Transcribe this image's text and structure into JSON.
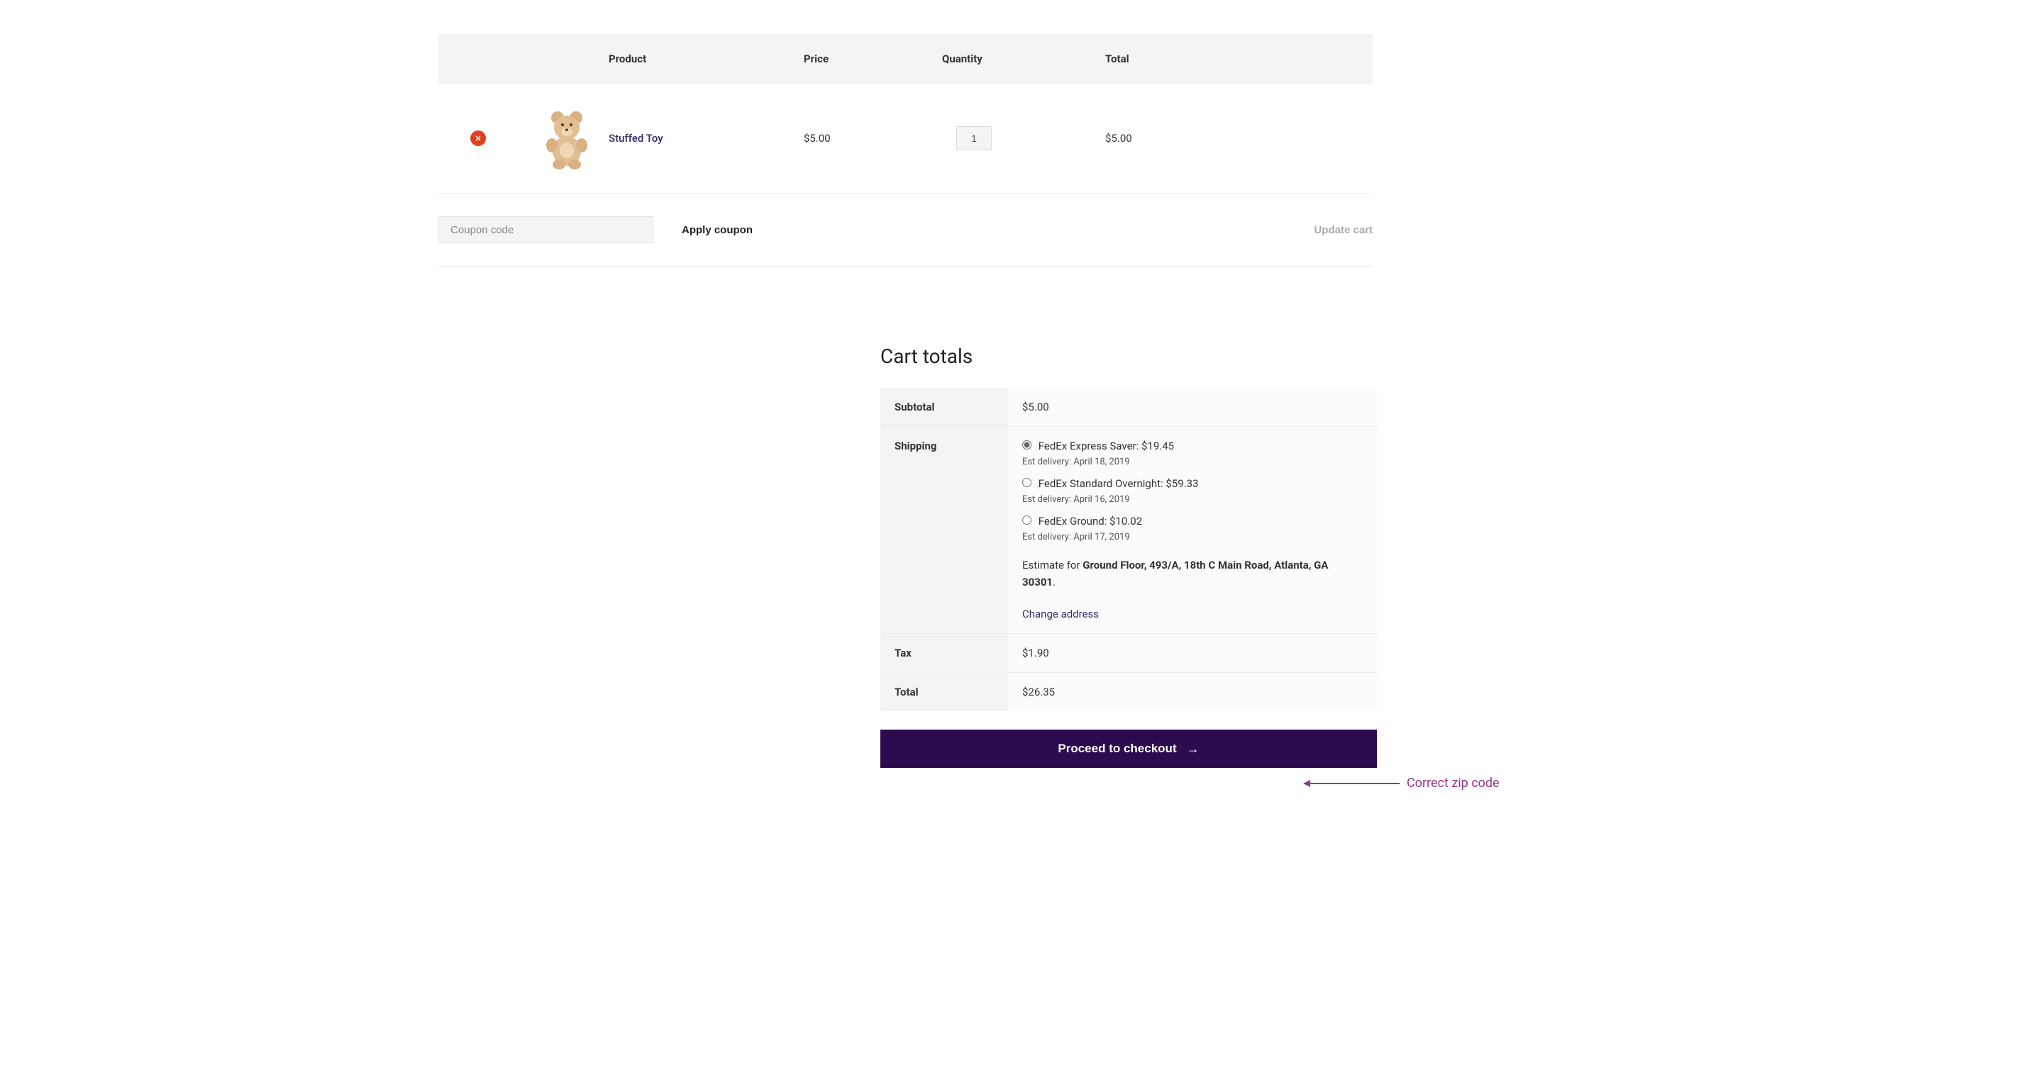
{
  "cart_table": {
    "headers": {
      "product": "Product",
      "price": "Price",
      "quantity": "Quantity",
      "total": "Total"
    },
    "items": [
      {
        "name": "Stuffed Toy",
        "price": "$5.00",
        "qty": "1",
        "line_total": "$5.00"
      }
    ]
  },
  "coupon": {
    "placeholder": "Coupon code",
    "apply_label": "Apply coupon"
  },
  "update_cart_label": "Update cart",
  "cart_totals": {
    "title": "Cart totals",
    "subtotal_label": "Subtotal",
    "subtotal_value": "$5.00",
    "shipping_label": "Shipping",
    "shipping_options": [
      {
        "label": "FedEx Express Saver: $19.45",
        "est": "Est delivery: April 18, 2019",
        "checked": true
      },
      {
        "label": "FedEx Standard Overnight: $59.33",
        "est": "Est delivery: April 16, 2019",
        "checked": false
      },
      {
        "label": "FedEx Ground: $10.02",
        "est": "Est delivery: April 17, 2019",
        "checked": false
      }
    ],
    "estimate_prefix": "Estimate for ",
    "estimate_address": "Ground Floor, 493/A, 18th C Main Road, Atlanta, GA 30301",
    "change_address_label": "Change address",
    "tax_label": "Tax",
    "tax_value": "$1.90",
    "total_label": "Total",
    "total_value": "$26.35"
  },
  "checkout_label": "Proceed to checkout",
  "annotation_text": "Correct zip code"
}
